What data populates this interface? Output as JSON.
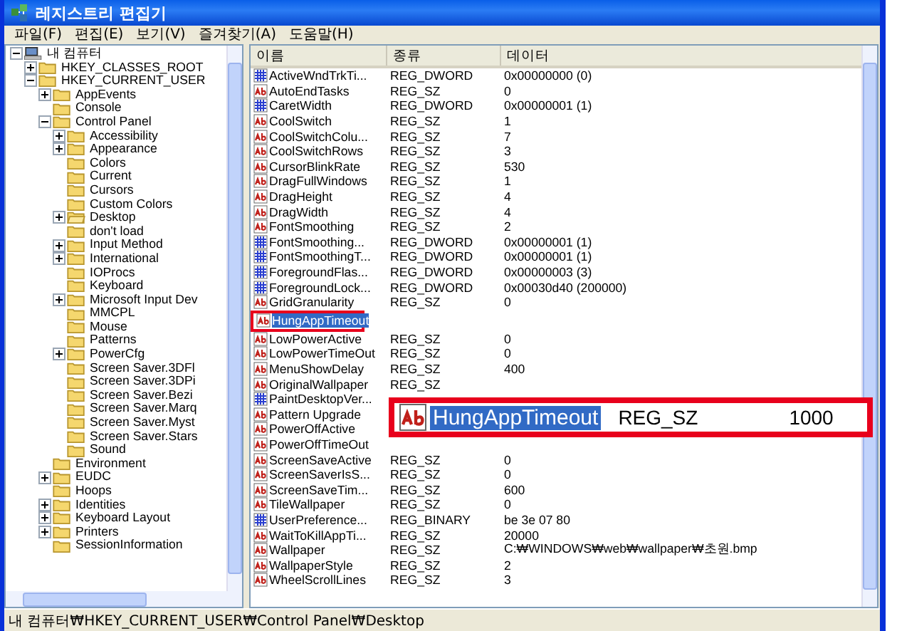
{
  "window": {
    "title": "레지스트리 편집기"
  },
  "menu": [
    "파일(F)",
    "편집(E)",
    "보기(V)",
    "즐겨찾기(A)",
    "도움말(H)"
  ],
  "tree": [
    {
      "label": "내 컴퓨터",
      "kind": "computer",
      "expanded": true,
      "children": [
        {
          "label": "HKEY_CLASSES_ROOT",
          "expanded": false
        },
        {
          "label": "HKEY_CURRENT_USER",
          "expanded": true,
          "children": [
            {
              "label": "AppEvents",
              "expanded": false
            },
            {
              "label": "Console"
            },
            {
              "label": "Control Panel",
              "expanded": true,
              "children": [
                {
                  "label": "Accessibility",
                  "expanded": false
                },
                {
                  "label": "Appearance",
                  "expanded": false
                },
                {
                  "label": "Colors"
                },
                {
                  "label": "Current"
                },
                {
                  "label": "Cursors"
                },
                {
                  "label": "Custom Colors"
                },
                {
                  "label": "Desktop",
                  "expanded": false,
                  "open": true
                },
                {
                  "label": "don't load"
                },
                {
                  "label": "Input Method",
                  "expanded": false
                },
                {
                  "label": "International",
                  "expanded": false
                },
                {
                  "label": "IOProcs"
                },
                {
                  "label": "Keyboard"
                },
                {
                  "label": "Microsoft Input Dev",
                  "expanded": false
                },
                {
                  "label": "MMCPL"
                },
                {
                  "label": "Mouse"
                },
                {
                  "label": "Patterns"
                },
                {
                  "label": "PowerCfg",
                  "expanded": false
                },
                {
                  "label": "Screen Saver.3DFl"
                },
                {
                  "label": "Screen Saver.3DPi"
                },
                {
                  "label": "Screen Saver.Bezi"
                },
                {
                  "label": "Screen Saver.Marq"
                },
                {
                  "label": "Screen Saver.Myst"
                },
                {
                  "label": "Screen Saver.Stars"
                },
                {
                  "label": "Sound"
                }
              ]
            },
            {
              "label": "Environment"
            },
            {
              "label": "EUDC",
              "expanded": false
            },
            {
              "label": "Hoops"
            },
            {
              "label": "Identities",
              "expanded": false
            },
            {
              "label": "Keyboard Layout",
              "expanded": false
            },
            {
              "label": "Printers",
              "expanded": false
            },
            {
              "label": "SessionInformation"
            }
          ]
        }
      ]
    }
  ],
  "table": {
    "columns": [
      "이름",
      "종류",
      "데이터"
    ],
    "rows": [
      {
        "kind": "binary",
        "name": "ActiveWndTrkTi...",
        "type": "REG_DWORD",
        "data": "0x00000000 (0)",
        "selected": false,
        "marked": false
      },
      {
        "kind": "string",
        "name": "AutoEndTasks",
        "type": "REG_SZ",
        "data": "0",
        "selected": false,
        "marked": false
      },
      {
        "kind": "binary",
        "name": "CaretWidth",
        "type": "REG_DWORD",
        "data": "0x00000001 (1)",
        "selected": false,
        "marked": false
      },
      {
        "kind": "string",
        "name": "CoolSwitch",
        "type": "REG_SZ",
        "data": "1",
        "selected": false,
        "marked": false
      },
      {
        "kind": "string",
        "name": "CoolSwitchColu...",
        "type": "REG_SZ",
        "data": "7",
        "selected": false,
        "marked": false
      },
      {
        "kind": "string",
        "name": "CoolSwitchRows",
        "type": "REG_SZ",
        "data": "3",
        "selected": false,
        "marked": false
      },
      {
        "kind": "string",
        "name": "CursorBlinkRate",
        "type": "REG_SZ",
        "data": "530",
        "selected": false,
        "marked": false
      },
      {
        "kind": "string",
        "name": "DragFullWindows",
        "type": "REG_SZ",
        "data": "1",
        "selected": false,
        "marked": false
      },
      {
        "kind": "string",
        "name": "DragHeight",
        "type": "REG_SZ",
        "data": "4",
        "selected": false,
        "marked": false
      },
      {
        "kind": "string",
        "name": "DragWidth",
        "type": "REG_SZ",
        "data": "4",
        "selected": false,
        "marked": false
      },
      {
        "kind": "string",
        "name": "FontSmoothing",
        "type": "REG_SZ",
        "data": "2",
        "selected": false,
        "marked": false
      },
      {
        "kind": "binary",
        "name": "FontSmoothing...",
        "type": "REG_DWORD",
        "data": "0x00000001 (1)",
        "selected": false,
        "marked": false
      },
      {
        "kind": "binary",
        "name": "FontSmoothingT...",
        "type": "REG_DWORD",
        "data": "0x00000001 (1)",
        "selected": false,
        "marked": false
      },
      {
        "kind": "binary",
        "name": "ForegroundFlas...",
        "type": "REG_DWORD",
        "data": "0x00000003 (3)",
        "selected": false,
        "marked": false
      },
      {
        "kind": "binary",
        "name": "ForegroundLock...",
        "type": "REG_DWORD",
        "data": "0x00030d40 (200000)",
        "selected": false,
        "marked": false
      },
      {
        "kind": "string",
        "name": "GridGranularity",
        "type": "REG_SZ",
        "data": "0",
        "selected": false,
        "marked": false
      },
      {
        "kind": "string",
        "name": "HungAppTimeout",
        "selected": true,
        "marked": true
      },
      {
        "kind": "string",
        "name": "LowPowerActive",
        "type": "REG_SZ",
        "data": "0",
        "selected": false,
        "marked": false
      },
      {
        "kind": "string",
        "name": "LowPowerTimeOut",
        "type": "REG_SZ",
        "data": "0",
        "selected": false,
        "marked": false
      },
      {
        "kind": "string",
        "name": "MenuShowDelay",
        "type": "REG_SZ",
        "data": "400",
        "selected": false,
        "marked": false
      },
      {
        "kind": "string",
        "name": "OriginalWallpaper",
        "type": "REG_SZ",
        "selected": false,
        "marked": false
      },
      {
        "kind": "binary",
        "name": "PaintDesktopVer...",
        "selected": false,
        "marked": false
      },
      {
        "kind": "string",
        "name": "Pattern Upgrade",
        "selected": false,
        "marked": false
      },
      {
        "kind": "string",
        "name": "PowerOffActive",
        "selected": false,
        "marked": false
      },
      {
        "kind": "string",
        "name": "PowerOffTimeOut",
        "selected": false,
        "marked": false
      },
      {
        "kind": "string",
        "name": "ScreenSaveActive",
        "type": "REG_SZ",
        "data": "0",
        "selected": false,
        "marked": false
      },
      {
        "kind": "string",
        "name": "ScreenSaverIsS...",
        "type": "REG_SZ",
        "data": "0",
        "selected": false,
        "marked": false
      },
      {
        "kind": "string",
        "name": "ScreenSaveTim...",
        "type": "REG_SZ",
        "data": "600",
        "selected": false,
        "marked": false
      },
      {
        "kind": "string",
        "name": "TileWallpaper",
        "type": "REG_SZ",
        "data": "0",
        "selected": false,
        "marked": false
      },
      {
        "kind": "binary",
        "name": "UserPreference...",
        "type": "REG_BINARY",
        "data": "be 3e 07 80",
        "selected": false,
        "marked": false
      },
      {
        "kind": "string",
        "name": "WaitToKillAppTi...",
        "type": "REG_SZ",
        "data": "20000",
        "selected": false,
        "marked": false
      },
      {
        "kind": "string",
        "name": "Wallpaper",
        "type": "REG_SZ",
        "data": "C:₩WINDOWS₩web₩wallpaper₩초원.bmp",
        "selected": false,
        "marked": false
      },
      {
        "kind": "string",
        "name": "WallpaperStyle",
        "type": "REG_SZ",
        "data": "2",
        "selected": false,
        "marked": false
      },
      {
        "kind": "string",
        "name": "WheelScrollLines",
        "type": "REG_SZ",
        "data": "3",
        "selected": false,
        "marked": false
      }
    ]
  },
  "callout": {
    "kind": "string",
    "name": "HungAppTimeout",
    "type": "REG_SZ",
    "data": "1000"
  },
  "status_bar": "내 컴퓨터₩HKEY_CURRENT_USER₩Control Panel₩Desktop"
}
